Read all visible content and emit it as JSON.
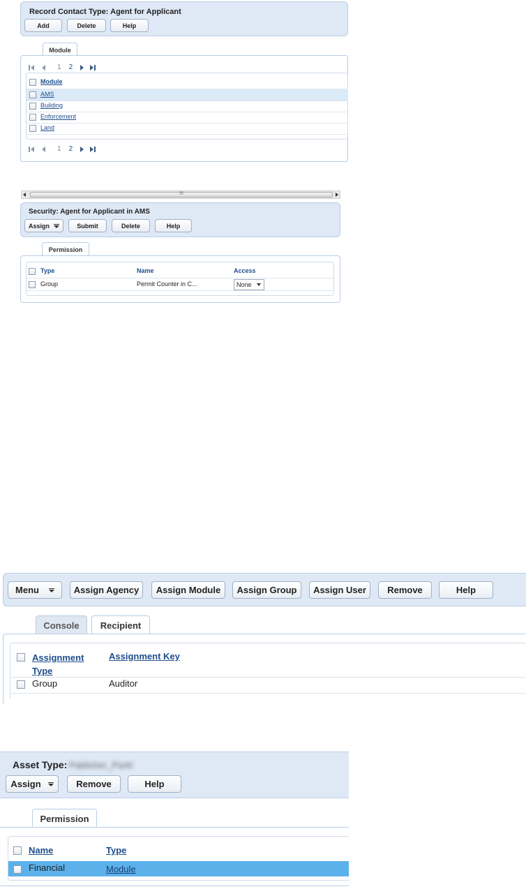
{
  "panel1": {
    "title": "Record Contact Type: Agent for Applicant",
    "buttons": {
      "add": "Add",
      "delete": "Delete",
      "help": "Help"
    },
    "tab": "Module",
    "pager": {
      "page1": "1",
      "page2": "2"
    },
    "table": {
      "header": "Module",
      "rows": [
        {
          "name": "AMS",
          "selected": true
        },
        {
          "name": "Building",
          "selected": false
        },
        {
          "name": "Enforcement",
          "selected": false
        },
        {
          "name": "Land",
          "selected": false
        }
      ]
    },
    "scroll_grip": "III"
  },
  "panel2": {
    "title": "Security: Agent for Applicant in AMS",
    "buttons": {
      "assign": "Assign",
      "submit": "Submit",
      "delete": "Delete",
      "help": "Help"
    },
    "tab": "Permission",
    "table": {
      "headers": {
        "type": "Type",
        "name": "Name",
        "access": "Access"
      },
      "rows": [
        {
          "type": "Group",
          "name": "Permit Counter in C...",
          "access": "None"
        }
      ]
    }
  },
  "panel3": {
    "buttons": {
      "menu": "Menu",
      "assign_agency": "Assign Agency",
      "assign_module": "Assign Module",
      "assign_group": "Assign Group",
      "assign_user": "Assign User",
      "remove": "Remove",
      "help": "Help"
    },
    "tabs": {
      "console": "Console",
      "recipient": "Recipient"
    },
    "table": {
      "headers": {
        "assignment_type_1": "Assignment",
        "assignment_type_2": "Type",
        "assignment_key": "Assignment Key"
      },
      "rows": [
        {
          "type": "Group",
          "key": "Auditor"
        }
      ]
    }
  },
  "panel4": {
    "title": "Asset Type:",
    "title_value": "Pablisher_Parkl",
    "buttons": {
      "assign": "Assign",
      "remove": "Remove",
      "help": "Help"
    },
    "tab": "Permission",
    "table": {
      "headers": {
        "name": "Name",
        "type": "Type"
      },
      "rows": [
        {
          "name": "Financial",
          "type": "Module",
          "selected": true
        }
      ]
    }
  },
  "colors": {
    "panel_bg": "#dfe9f6",
    "selected_row_light": "#dbeaf7",
    "selected_row_strong": "#5cb1ea",
    "link": "#1f4e8c"
  }
}
